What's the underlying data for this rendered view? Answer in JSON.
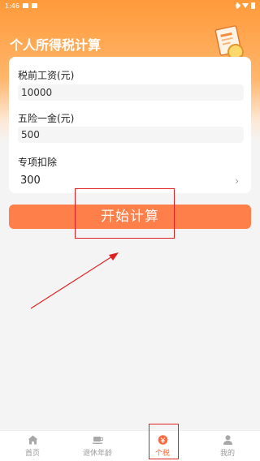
{
  "status_bar": {
    "time": "1:46"
  },
  "header": {
    "title": "个人所得税计算"
  },
  "form": {
    "salary": {
      "label": "税前工资(元)",
      "value": "10000"
    },
    "insurance": {
      "label": "五险一金(元)",
      "value": "500"
    },
    "deduction": {
      "label": "专项扣除",
      "value": "300",
      "chevron": "›"
    }
  },
  "start_button": {
    "label": "开始计算"
  },
  "tab_bar": {
    "items": [
      {
        "label": "首页",
        "icon": "home-icon"
      },
      {
        "label": "退休年龄",
        "icon": "coffee-icon"
      },
      {
        "label": "个税",
        "icon": "tax-icon",
        "active": true
      },
      {
        "label": "我的",
        "icon": "user-icon"
      }
    ]
  },
  "colors": {
    "accent": "#ff7f4b",
    "header": "#ff9a3a",
    "annotation": "#e02020"
  }
}
